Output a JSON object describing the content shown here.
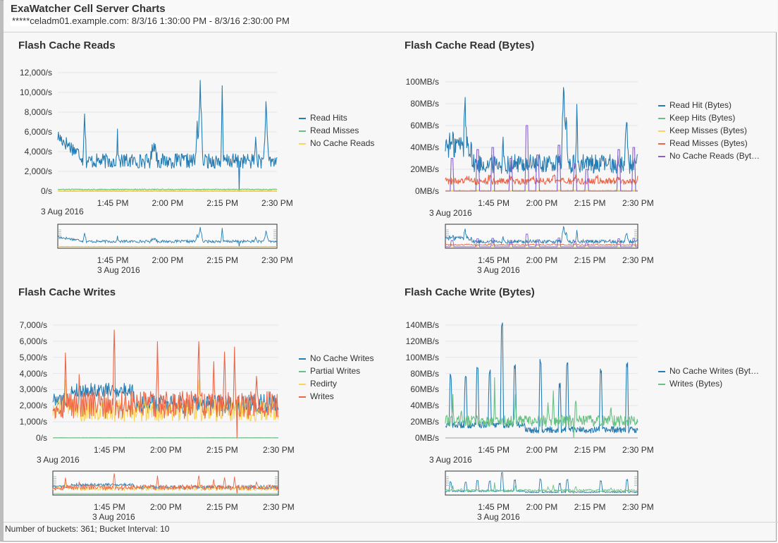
{
  "header": {
    "title": "ExaWatcher Cell Server Charts",
    "subtitle": "*****celadm01.example.com: 8/3/16 1:30:00 PM - 8/3/16 2:30:00 PM"
  },
  "footer": {
    "text": "Number of buckets: 361; Bucket Interval: 10"
  },
  "chart_data": [
    {
      "type": "line",
      "title": "Flash Cache Reads",
      "xlabel": "",
      "ylabel": "",
      "x_range": [
        "1:30 PM",
        "2:30 PM"
      ],
      "x_date": "3 Aug 2016",
      "x_ticks": [
        "1:45 PM",
        "2:00 PM",
        "2:15 PM",
        "2:30 PM"
      ],
      "y_ticks": [
        "0/s",
        "2,000/s",
        "4,000/s",
        "6,000/s",
        "8,000/s",
        "10,000/s",
        "12,000/s"
      ],
      "ylim": [
        0,
        12000
      ],
      "legend_position": "right",
      "series": [
        {
          "name": "Read Hits",
          "color": "#267db3",
          "approx_profile": "baseline ~2500-4000/s, spikes 9200 at ~1:37, 11500 at ~2:09, 10200 at ~2:13, 8700 at ~2:27; early values ~5000-6000"
        },
        {
          "name": "Read Misses",
          "color": "#68c182",
          "approx_profile": "~100-200/s throughout"
        },
        {
          "name": "No Cache Reads",
          "color": "#fad55c",
          "approx_profile": "~0-50/s throughout"
        }
      ],
      "overview": true
    },
    {
      "type": "line",
      "title": "Flash Cache Read (Bytes)",
      "x_range": [
        "1:30 PM",
        "2:30 PM"
      ],
      "x_date": "3 Aug 2016",
      "x_ticks": [
        "1:45 PM",
        "2:00 PM",
        "2:15 PM",
        "2:30 PM"
      ],
      "y_ticks": [
        "0MB/s",
        "20MB/s",
        "40MB/s",
        "60MB/s",
        "80MB/s",
        "100MB/s"
      ],
      "ylim": [
        0,
        100
      ],
      "legend_position": "right",
      "series": [
        {
          "name": "Read Hit (Bytes)",
          "color": "#267db3",
          "approx_profile": "baseline ~20-35 MB/s, spikes 72 at ~1:39, 103 at ~2:09, 83 at ~2:13, 68 at ~2:27"
        },
        {
          "name": "Keep Hits (Bytes)",
          "color": "#68c182",
          "approx_profile": "~0 MB/s"
        },
        {
          "name": "Keep Misses (Bytes)",
          "color": "#fad55c",
          "approx_profile": "~0 MB/s"
        },
        {
          "name": "Read Misses (Bytes)",
          "color": "#ed6647",
          "approx_profile": "~5-12 MB/s throughout"
        },
        {
          "name": "No Cache Reads (Byt…",
          "color": "#8561c8",
          "approx_profile": "periodic pulses 30-60 MB/s, else 0"
        }
      ],
      "overview": true
    },
    {
      "type": "line",
      "title": "Flash Cache Writes",
      "x_range": [
        "1:30 PM",
        "2:30 PM"
      ],
      "x_date": "3 Aug 2016",
      "x_ticks": [
        "1:45 PM",
        "2:00 PM",
        "2:15 PM",
        "2:30 PM"
      ],
      "y_ticks": [
        "0/s",
        "1,000/s",
        "2,000/s",
        "3,000/s",
        "4,000/s",
        "5,000/s",
        "6,000/s",
        "7,000/s"
      ],
      "ylim": [
        0,
        7000
      ],
      "legend_position": "right",
      "series": [
        {
          "name": "No Cache Writes",
          "color": "#267db3",
          "approx_profile": "~1500-3500/s"
        },
        {
          "name": "Partial Writes",
          "color": "#68c182",
          "approx_profile": "~0/s"
        },
        {
          "name": "Redirty",
          "color": "#fad55c",
          "approx_profile": "~800-2500/s"
        },
        {
          "name": "Writes",
          "color": "#ed6647",
          "approx_profile": "~1000-3000/s, spikes 5200, 7000 at ~1:48, 5400, 6800 at ~2:09, 5700, 4600, 4300"
        }
      ],
      "overview": true
    },
    {
      "type": "line",
      "title": "Flash Cache Write (Bytes)",
      "x_range": [
        "1:30 PM",
        "2:30 PM"
      ],
      "x_date": "3 Aug 2016",
      "x_ticks": [
        "1:45 PM",
        "2:00 PM",
        "2:15 PM",
        "2:30 PM"
      ],
      "y_ticks": [
        "0MB/s",
        "20MB/s",
        "40MB/s",
        "60MB/s",
        "80MB/s",
        "100MB/s",
        "120MB/s",
        "140MB/s"
      ],
      "ylim": [
        0,
        140
      ],
      "legend_position": "right",
      "series": [
        {
          "name": "No Cache Writes (Byt…",
          "color": "#267db3",
          "approx_profile": "baseline ~10-18 MB/s, periodic spikes 75-100 MB/s, peak 140 at ~1:52"
        },
        {
          "name": "Writes (Bytes)",
          "color": "#68c182",
          "approx_profile": "~10-30 MB/s, spikes up to ~66 MB/s"
        }
      ],
      "overview": true
    }
  ]
}
